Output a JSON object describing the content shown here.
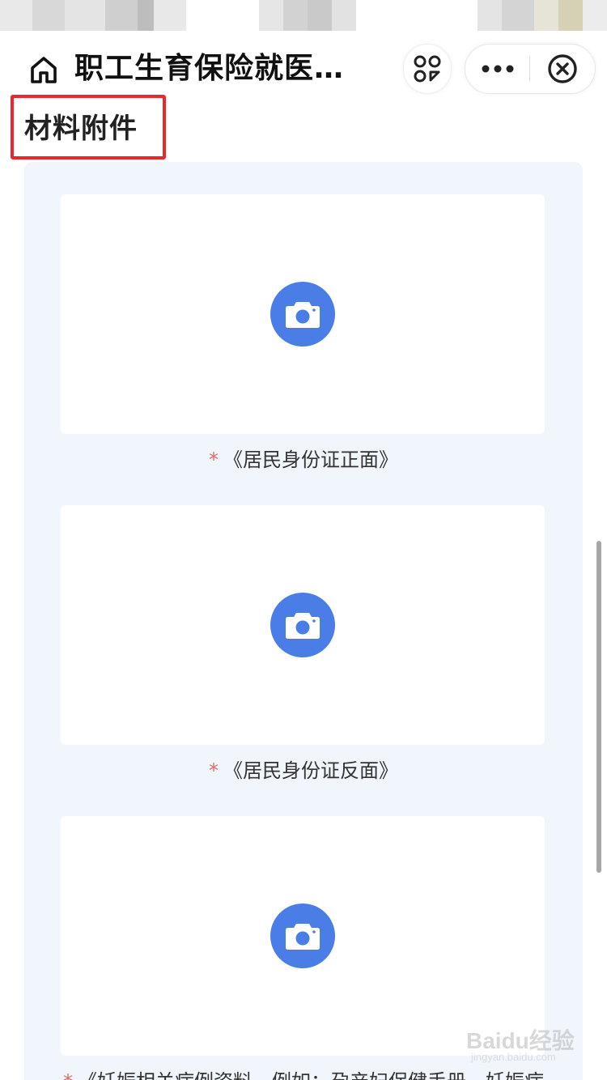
{
  "nav": {
    "title": "职工生育保险就医…",
    "home_icon": "home-icon",
    "scan_icon": "scan-icon",
    "more_icon": "more-dots-icon",
    "close_icon": "close-circle-icon"
  },
  "section": {
    "title": "材料附件"
  },
  "uploads": [
    {
      "required_mark": "*",
      "label": "《居民身份证正面》",
      "icon": "camera-icon"
    },
    {
      "required_mark": "*",
      "label": "《居民身份证反面》",
      "icon": "camera-icon"
    },
    {
      "required_mark": "*",
      "label": "《妊娠相关病例资料，例如：孕产妇保健手册、妊娠病",
      "icon": "camera-icon"
    }
  ],
  "watermark": {
    "brand": "Baidu经验",
    "url": "jingyan.baidu.com"
  },
  "colors": {
    "accent": "#4a7de6",
    "panel_background": "#f1f5fc",
    "required_star": "#e36a6a",
    "annotation_red": "#e8282b"
  }
}
